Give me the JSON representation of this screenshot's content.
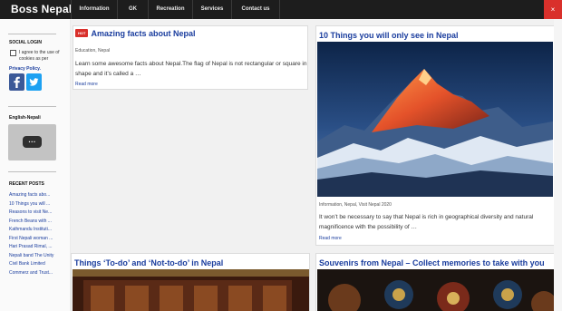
{
  "site": {
    "brand": "Boss Nepal",
    "close_label": "×"
  },
  "nav": [
    {
      "label": "Information"
    },
    {
      "label": "GK"
    },
    {
      "label": "Recreation"
    },
    {
      "label": "Services"
    },
    {
      "label": "Contact us"
    }
  ],
  "sidebar": {
    "social_heading": "SOCIAL LOGIN",
    "consent_text": "I agree to the use of cookies as per",
    "privacy_link": "Privacy Policy.",
    "social_buttons": [
      {
        "icon": "facebook-icon",
        "color": "#3b5998"
      },
      {
        "icon": "twitter-icon",
        "color": "#1da1f2"
      }
    ],
    "translate_heading": "English-Nepali",
    "translate_button": "...",
    "recent_heading": "RECENT POSTS",
    "recent_posts": [
      "Amazing facts abo...",
      "10 Things you will ...",
      "Reasons to visit Ne...",
      "French Beans with ...",
      "Kathmandu Instituti...",
      "First Nepali woman ...",
      "Hari Prasad Rimal, ...",
      "Nepali band The Unity",
      "Civil Bank Limited",
      "Commerz and Trust..."
    ]
  },
  "posts": [
    {
      "badge": "HOT",
      "title": "Amazing facts about Nepal",
      "categories": "Education, Nepal",
      "excerpt": "Learn some awesome facts about Nepal.The flag of Nepal is not rectangular or square in shape and it’s called a …",
      "read_more": "Read more"
    },
    {
      "title": "10 Things you will only see in Nepal",
      "categories": "Information, Nepal, Visit Nepal 2020",
      "excerpt": "It won’t be necessary to say that Nepal is rich in geographical diversity and natural magnificence with the possibility of …",
      "read_more": "Read more"
    },
    {
      "title": "Things ‘To-do’ and ‘Not-to-do’ in Nepal"
    },
    {
      "title": "Souvenirs from Nepal – Collect memories to take with you"
    }
  ],
  "colors": {
    "topbar": "#1d1d1d",
    "accent_red": "#d9302b",
    "link_blue": "#1a3d9e"
  }
}
